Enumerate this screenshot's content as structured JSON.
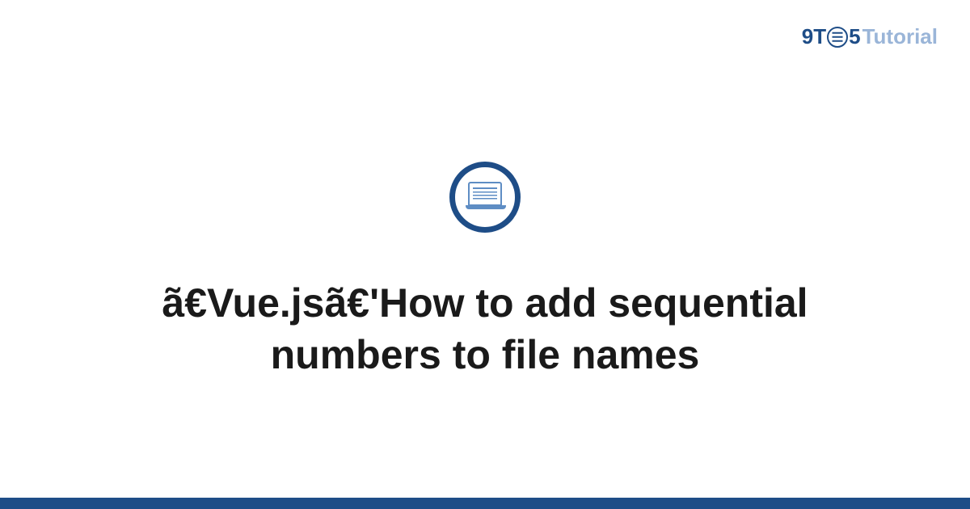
{
  "logo": {
    "prefix": "9T",
    "suffix": "5",
    "word": "Tutorial"
  },
  "title": "ã€Vue.jsã€'How to add sequential numbers to file names",
  "colors": {
    "brand": "#1e4d87",
    "brandLight": "#9ab5d8",
    "iconStroke": "#5e8dc4"
  }
}
